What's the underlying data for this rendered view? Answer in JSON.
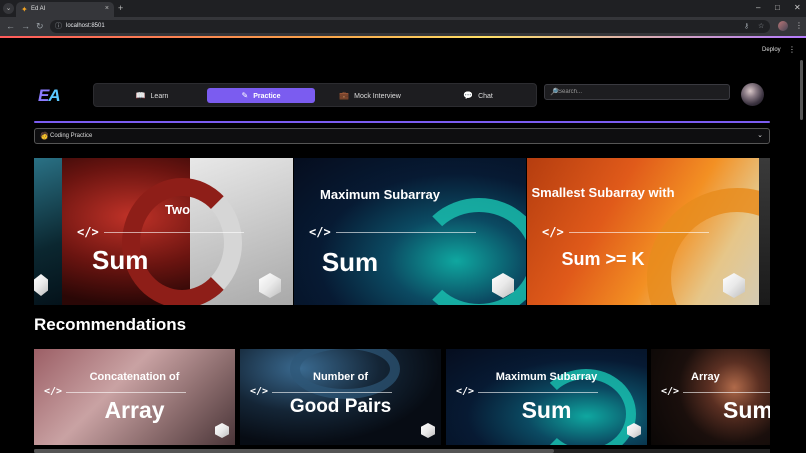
{
  "browser": {
    "tab_title": "Ed AI",
    "url": "localhost:8501",
    "new_tab": "+",
    "tab_close": "×",
    "minimize": "–",
    "maximize": "□",
    "close": "✕"
  },
  "app": {
    "deploy_label": "Deploy",
    "logo_left": "E",
    "logo_right": "A",
    "nav": {
      "learn": "Learn",
      "practice": "Practice",
      "mock_interview": "Mock Interview",
      "chat": "Chat"
    },
    "search_placeholder": "Search...",
    "dropdown_label": "Coding Practice",
    "recommendations_title": "Recommendations"
  },
  "featured": [
    {
      "top": "Two",
      "bottom": "Sum"
    },
    {
      "top": "Maximum Subarray",
      "bottom": "Sum"
    },
    {
      "top": "Smallest Subarray with",
      "bottom": "Sum >= K"
    }
  ],
  "recommendations": [
    {
      "top": "Concatenation of",
      "bottom": "Array"
    },
    {
      "top": "Number of",
      "bottom": "Good Pairs"
    },
    {
      "top": "Maximum Subarray",
      "bottom": "Sum"
    },
    {
      "top": "Array",
      "bottom": "Sum"
    }
  ],
  "colors": {
    "accent": "#7b5cf0",
    "background": "#000000"
  },
  "icons": {
    "code": "</>",
    "learn": "book-icon",
    "practice": "edit-icon",
    "mock_interview": "briefcase-icon",
    "chat": "chat-bubble-icon",
    "search": "search-icon",
    "dropdown": "chevron-down-icon"
  }
}
